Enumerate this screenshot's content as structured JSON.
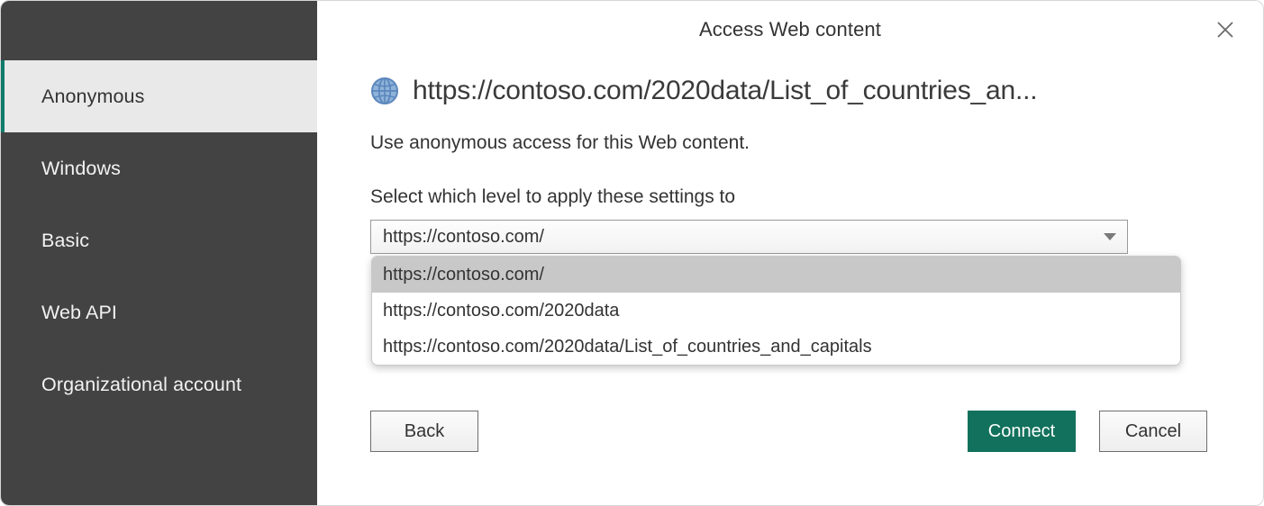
{
  "dialog": {
    "title": "Access Web content",
    "close_icon": "close-icon",
    "accent_color": "#107C6C",
    "primary_button_color": "#12715C",
    "sidebar_bg": "#434343",
    "active_item_bg": "#e9e9e9"
  },
  "sidebar": {
    "items": [
      {
        "label": "Anonymous",
        "active": true
      },
      {
        "label": "Windows",
        "active": false
      },
      {
        "label": "Basic",
        "active": false
      },
      {
        "label": "Web API",
        "active": false
      },
      {
        "label": "Organizational account",
        "active": false
      }
    ]
  },
  "main": {
    "url_icon": "globe-icon",
    "url": "https://contoso.com/2020data/List_of_countries_an...",
    "description": "Use anonymous access for this Web content.",
    "level_label": "Select which level to apply these settings to",
    "level_select": {
      "value": "https://contoso.com/",
      "arrow_icon": "chevron-down-icon",
      "expanded": true,
      "options": [
        {
          "label": "https://contoso.com/",
          "selected": true
        },
        {
          "label": "https://contoso.com/2020data",
          "selected": false
        },
        {
          "label": "https://contoso.com/2020data/List_of_countries_and_capitals",
          "selected": false
        }
      ]
    }
  },
  "footer": {
    "back_label": "Back",
    "connect_label": "Connect",
    "cancel_label": "Cancel"
  }
}
